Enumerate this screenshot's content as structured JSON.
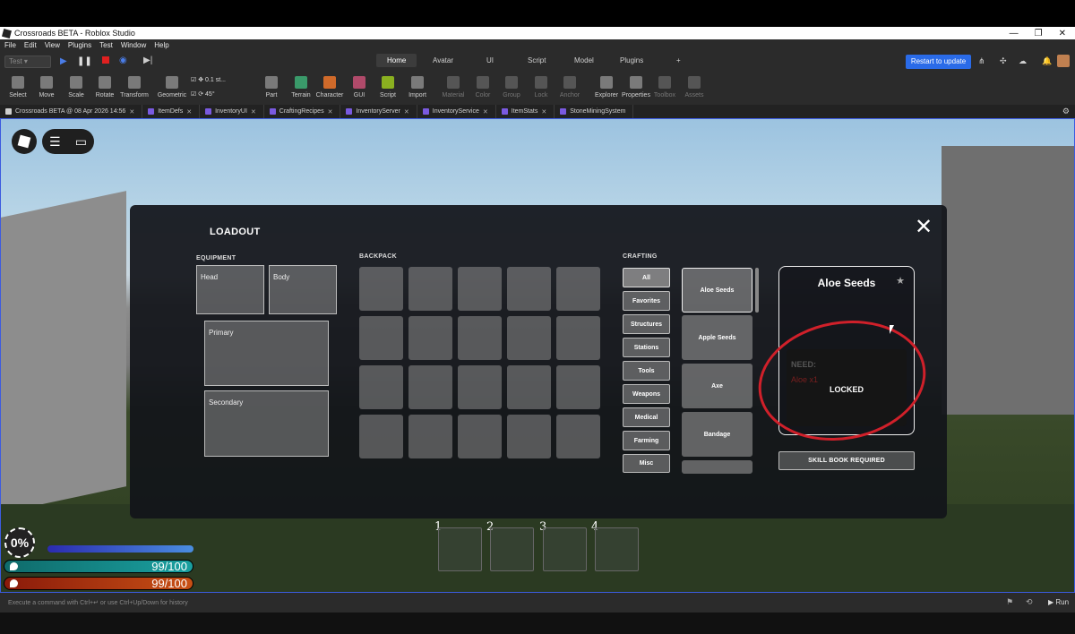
{
  "window": {
    "title": "Crossroads BETA - Roblox Studio"
  },
  "menu": [
    "File",
    "Edit",
    "View",
    "Plugins",
    "Test",
    "Window",
    "Help"
  ],
  "play_mode": "Test",
  "ribbon_tabs": [
    "Home",
    "Avatar",
    "UI",
    "Script",
    "Model",
    "Plugins",
    "+"
  ],
  "restart_label": "Restart to update",
  "tools": [
    {
      "label": "Select"
    },
    {
      "label": "Move"
    },
    {
      "label": "Scale"
    },
    {
      "label": "Rotate"
    },
    {
      "label": "Transform"
    },
    {
      "label": "Geometric"
    },
    {
      "label": "Part"
    },
    {
      "label": "Terrain"
    },
    {
      "label": "Character"
    },
    {
      "label": "GUI"
    },
    {
      "label": "Script"
    },
    {
      "label": "Import"
    },
    {
      "label": "Material"
    },
    {
      "label": "Color"
    },
    {
      "label": "Group"
    },
    {
      "label": "Lock"
    },
    {
      "label": "Anchor"
    },
    {
      "label": "Explorer"
    },
    {
      "label": "Properties"
    },
    {
      "label": "Toolbox"
    },
    {
      "label": "Assets"
    }
  ],
  "snap": {
    "move": "0.1 st...",
    "rotate": "45°"
  },
  "file_tabs": [
    "Crossroads BETA @ 08 Apr 2026 14:56",
    "ItemDefs",
    "InventoryUI",
    "CraftingRecipes",
    "InventoryServer",
    "InventoryService",
    "ItemStats",
    "StoneMiningSystem"
  ],
  "loadout": {
    "title": "LOADOUT",
    "equipment_label": "EQUIPMENT",
    "backpack_label": "BACKPACK",
    "crafting_label": "CRAFTING",
    "slots": {
      "head": "Head",
      "body": "Body",
      "primary": "Primary",
      "secondary": "Secondary"
    },
    "categories": [
      "All",
      "Favorites",
      "Structures",
      "Stations",
      "Tools",
      "Weapons",
      "Medical",
      "Farming",
      "Misc"
    ],
    "recipes": [
      "Aloe Seeds",
      "Apple Seeds",
      "Axe",
      "Bandage"
    ],
    "detail": {
      "title": "Aloe Seeds",
      "need_label": "NEED:",
      "need_item": "Aloe x1",
      "status": "LOCKED",
      "skill_button": "SKILL BOOK REQUIRED"
    },
    "close": "✕"
  },
  "hotbar": [
    "1",
    "2",
    "3",
    "4"
  ],
  "hud": {
    "level": "0%",
    "water": "99/100",
    "food": "99/100"
  },
  "command_hint": "Execute a command with Ctrl+↵ or use Ctrl+Up/Down for history",
  "run_label": "Run"
}
